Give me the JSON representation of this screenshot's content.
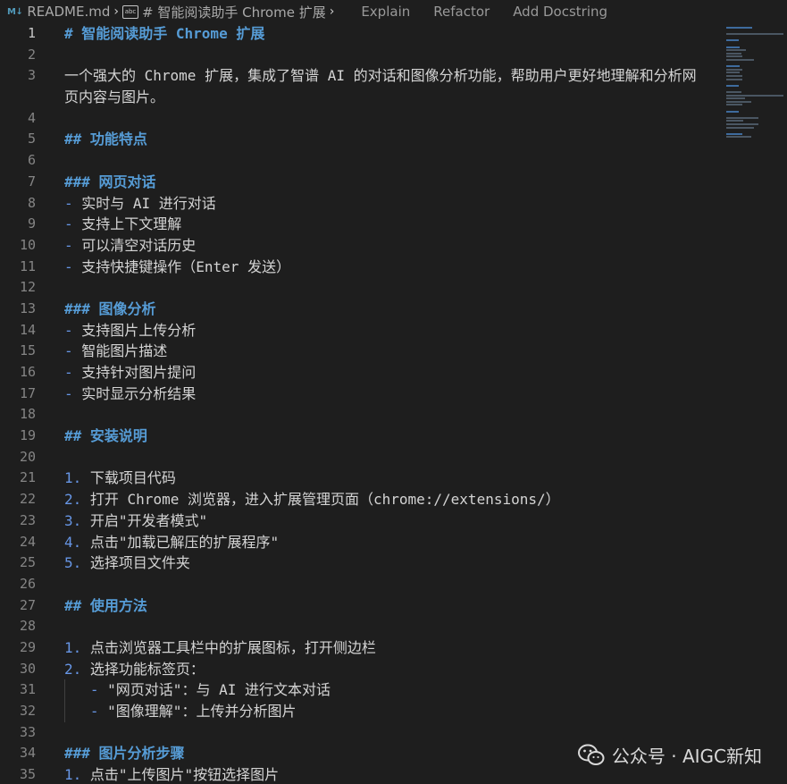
{
  "breadcrumb": {
    "file_icon": "M↓",
    "file": "README.md",
    "symbol_icon": "abc",
    "symbol": "# 智能阅读助手 Chrome 扩展",
    "codelens": [
      "Explain",
      "Refactor",
      "Add Docstring"
    ]
  },
  "editor": {
    "active_line": 1,
    "lines": [
      {
        "n": "1",
        "parts": [
          {
            "c": "hdr",
            "t": "# 智能阅读助手 Chrome 扩展"
          }
        ]
      },
      {
        "n": "2",
        "parts": []
      },
      {
        "n": "3",
        "wrap": true,
        "parts": [
          {
            "c": "txt",
            "t": "一个强大的 Chrome 扩展，集成了智谱 AI 的对话和图像分析功能，帮助用户更好地理解和分析网页内容与图片。"
          }
        ]
      },
      {
        "n": "4",
        "parts": []
      },
      {
        "n": "5",
        "parts": [
          {
            "c": "hdr",
            "t": "## 功能特点"
          }
        ]
      },
      {
        "n": "6",
        "parts": []
      },
      {
        "n": "7",
        "parts": [
          {
            "c": "hdr",
            "t": "### 网页对话"
          }
        ]
      },
      {
        "n": "8",
        "parts": [
          {
            "c": "bul",
            "t": "- "
          },
          {
            "c": "txt",
            "t": "实时与 AI 进行对话"
          }
        ]
      },
      {
        "n": "9",
        "parts": [
          {
            "c": "bul",
            "t": "- "
          },
          {
            "c": "txt",
            "t": "支持上下文理解"
          }
        ]
      },
      {
        "n": "10",
        "parts": [
          {
            "c": "bul",
            "t": "- "
          },
          {
            "c": "txt",
            "t": "可以清空对话历史"
          }
        ]
      },
      {
        "n": "11",
        "parts": [
          {
            "c": "bul",
            "t": "- "
          },
          {
            "c": "txt",
            "t": "支持快捷键操作（Enter 发送）"
          }
        ]
      },
      {
        "n": "12",
        "parts": []
      },
      {
        "n": "13",
        "parts": [
          {
            "c": "hdr",
            "t": "### 图像分析"
          }
        ]
      },
      {
        "n": "14",
        "parts": [
          {
            "c": "bul",
            "t": "- "
          },
          {
            "c": "txt",
            "t": "支持图片上传分析"
          }
        ]
      },
      {
        "n": "15",
        "parts": [
          {
            "c": "bul",
            "t": "- "
          },
          {
            "c": "txt",
            "t": "智能图片描述"
          }
        ]
      },
      {
        "n": "16",
        "parts": [
          {
            "c": "bul",
            "t": "- "
          },
          {
            "c": "txt",
            "t": "支持针对图片提问"
          }
        ]
      },
      {
        "n": "17",
        "parts": [
          {
            "c": "bul",
            "t": "- "
          },
          {
            "c": "txt",
            "t": "实时显示分析结果"
          }
        ]
      },
      {
        "n": "18",
        "parts": []
      },
      {
        "n": "19",
        "parts": [
          {
            "c": "hdr",
            "t": "## 安装说明"
          }
        ]
      },
      {
        "n": "20",
        "parts": []
      },
      {
        "n": "21",
        "parts": [
          {
            "c": "num",
            "t": "1. "
          },
          {
            "c": "txt",
            "t": "下载项目代码"
          }
        ]
      },
      {
        "n": "22",
        "parts": [
          {
            "c": "num",
            "t": "2. "
          },
          {
            "c": "txt",
            "t": "打开 Chrome 浏览器，进入扩展管理页面（chrome://extensions/）"
          }
        ]
      },
      {
        "n": "23",
        "parts": [
          {
            "c": "num",
            "t": "3. "
          },
          {
            "c": "txt",
            "t": "开启\"开发者模式\""
          }
        ]
      },
      {
        "n": "24",
        "parts": [
          {
            "c": "num",
            "t": "4. "
          },
          {
            "c": "txt",
            "t": "点击\"加载已解压的扩展程序\""
          }
        ]
      },
      {
        "n": "25",
        "parts": [
          {
            "c": "num",
            "t": "5. "
          },
          {
            "c": "txt",
            "t": "选择项目文件夹"
          }
        ]
      },
      {
        "n": "26",
        "parts": []
      },
      {
        "n": "27",
        "parts": [
          {
            "c": "hdr",
            "t": "## 使用方法"
          }
        ]
      },
      {
        "n": "28",
        "parts": []
      },
      {
        "n": "29",
        "parts": [
          {
            "c": "num",
            "t": "1. "
          },
          {
            "c": "txt",
            "t": "点击浏览器工具栏中的扩展图标，打开侧边栏"
          }
        ]
      },
      {
        "n": "30",
        "parts": [
          {
            "c": "num",
            "t": "2. "
          },
          {
            "c": "txt",
            "t": "选择功能标签页："
          }
        ]
      },
      {
        "n": "31",
        "guide": true,
        "parts": [
          {
            "c": "txt",
            "t": "   "
          },
          {
            "c": "bul",
            "t": "- "
          },
          {
            "c": "txt",
            "t": "\"网页对话\"：与 AI 进行文本对话"
          }
        ]
      },
      {
        "n": "32",
        "guide": true,
        "parts": [
          {
            "c": "txt",
            "t": "   "
          },
          {
            "c": "bul",
            "t": "- "
          },
          {
            "c": "txt",
            "t": "\"图像理解\"：上传并分析图片"
          }
        ]
      },
      {
        "n": "33",
        "parts": []
      },
      {
        "n": "34",
        "parts": [
          {
            "c": "hdr",
            "t": "### 图片分析步骤"
          }
        ]
      },
      {
        "n": "35",
        "parts": [
          {
            "c": "num",
            "t": "1. "
          },
          {
            "c": "txt",
            "t": "点击\"上传图片\"按钮选择图片"
          }
        ]
      }
    ]
  },
  "watermark": {
    "icon": "wechat-icon",
    "text": "公众号 · AIGC新知"
  },
  "colors": {
    "background": "#1e1e1e",
    "heading": "#569cd6",
    "list_marker": "#6796e6",
    "text": "#d4d4d4",
    "line_number": "#858585"
  }
}
